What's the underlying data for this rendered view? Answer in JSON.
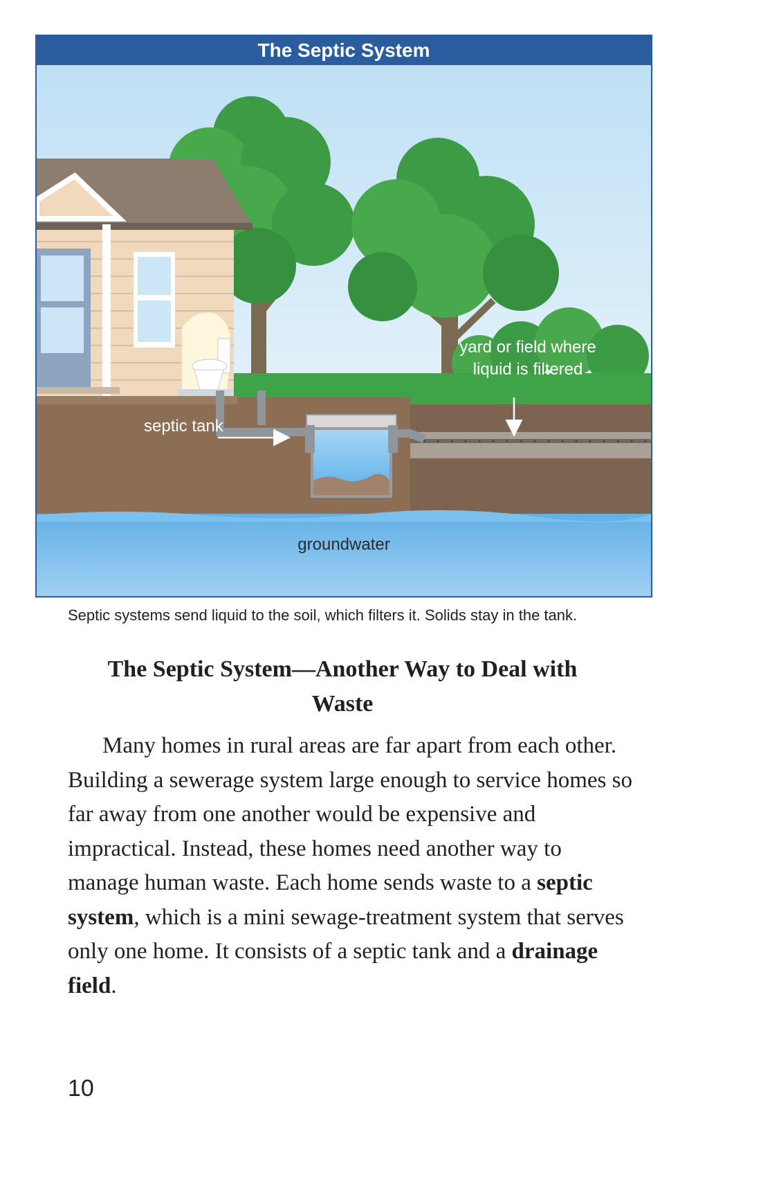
{
  "figure": {
    "title": "The Septic System",
    "labels": {
      "septic_tank": "septic tank",
      "field": "yard or field where liquid is filtered",
      "groundwater": "groundwater"
    },
    "caption": "Septic systems send liquid to the soil, which filters it. Solids stay in the tank."
  },
  "section": {
    "heading": "The Septic System—Another Way to Deal with Waste",
    "paragraph": {
      "part1": "Many homes in rural areas are far apart from each other. Building a sewerage system large enough to service homes so far away from one another would be expensive and impractical. Instead, these homes need another way to manage human waste. Each home sends waste to a ",
      "term1": "septic system",
      "part2": ", which is a mini sewage-treatment system that serves only one home. It consists of a septic tank and a ",
      "term2": "drainage field",
      "part3": "."
    }
  },
  "page_number": "10"
}
